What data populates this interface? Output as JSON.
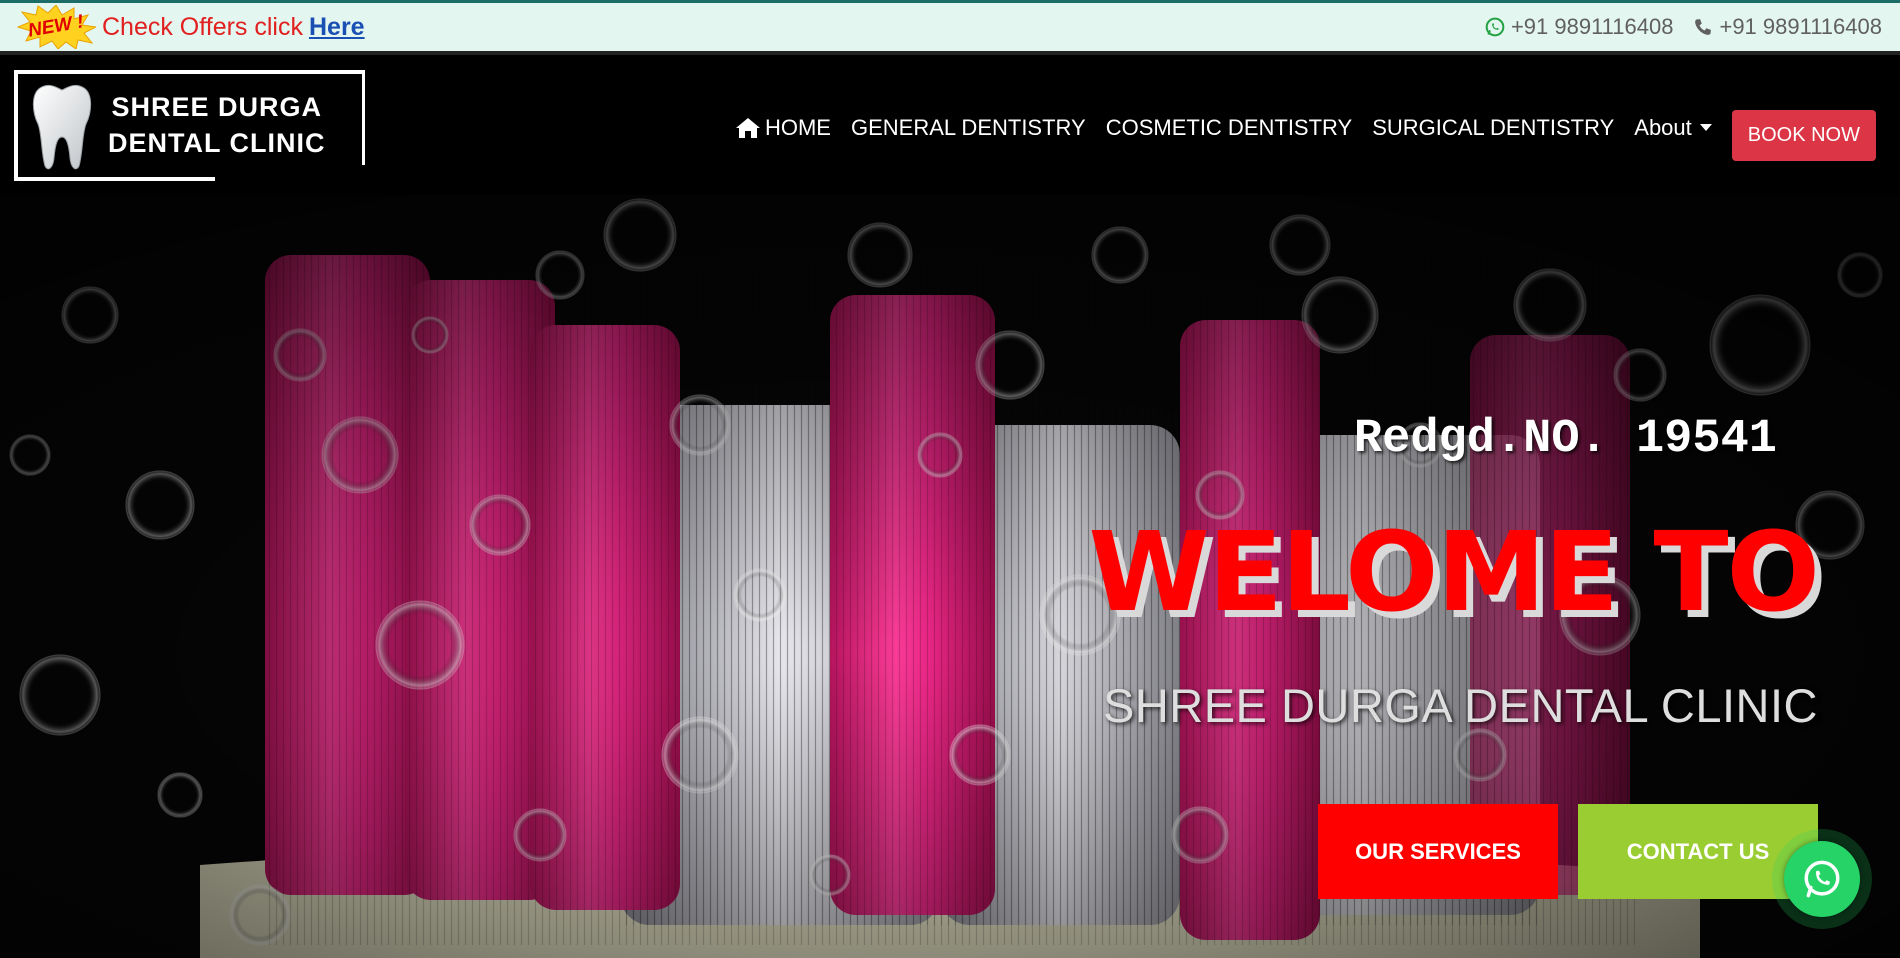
{
  "colors": {
    "topbar_bg": "#e4f6f0",
    "topbar_border": "#1c6d68",
    "offer_text": "#e12020",
    "offer_link": "#1a4fb3",
    "book_button": "#dc3545",
    "welcome_text": "#ff0000",
    "services_button": "#ff0000",
    "contact_button": "#9acd32",
    "whatsapp": "#25d366"
  },
  "topbar": {
    "badge": "NEW !",
    "offer_text": "Check Offers click",
    "offer_link": "Here",
    "whatsapp_icon": "whatsapp-icon",
    "whatsapp_number": "+91 9891116408",
    "phone_icon": "phone-icon",
    "phone_number": "+91 9891116408"
  },
  "logo": {
    "icon": "tooth-icon",
    "line1": "SHREE DURGA",
    "line2": "DENTAL CLINIC"
  },
  "nav": {
    "home_icon": "home-icon",
    "home": "HOME",
    "general": "GENERAL DENTISTRY",
    "cosmetic": "COSMETIC DENTISTRY",
    "surgical": "SURGICAL DENTISTRY",
    "about": "About",
    "book": "BOOK NOW"
  },
  "hero": {
    "reg": "Redgd.NO. 19541",
    "welcome": "WELOME TO",
    "subtitle": "SHREE DURGA DENTAL CLINIC",
    "services_button": "OUR SERVICES",
    "contact_button": "CONTACT US",
    "fab_icon": "whatsapp-icon"
  }
}
